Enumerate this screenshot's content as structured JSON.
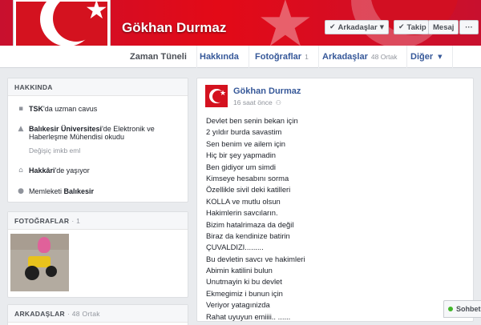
{
  "profile": {
    "name": "Gökhan Durmaz",
    "buttons": {
      "friends": "Arkadaşlar",
      "follow": "Takip",
      "message": "Mesaj",
      "more": "···"
    }
  },
  "nav": {
    "tabs": [
      {
        "label": "Zaman Tüneli",
        "count": ""
      },
      {
        "label": "Hakkında",
        "count": ""
      },
      {
        "label": "Fotoğraflar",
        "count": "1"
      },
      {
        "label": "Arkadaşlar",
        "count": "48 Ortak"
      },
      {
        "label": "Diğer",
        "count": ""
      }
    ]
  },
  "about": {
    "header": "HAKKINDA",
    "work": {
      "link": "TSK",
      "rest": "'da uzman cavus"
    },
    "education": {
      "link": "Balıkesir Üniversitesi",
      "rest": "'de Elektronik ve",
      "line2": "Haberleşme Mühendisi okudu",
      "sub": "Değişiç imkb eml"
    },
    "lives": {
      "link": "Hakkâri",
      "rest": "'de yaşıyor"
    },
    "from": {
      "prefix": "Memleketi ",
      "link": "Balıkesir"
    }
  },
  "photos": {
    "header": "FOTOĞRAFLAR",
    "count": "· 1"
  },
  "friends": {
    "header": "ARKADAŞLAR",
    "count": "· 48 Ortak"
  },
  "post": {
    "author": "Gökhan Durmaz",
    "time": "16 saat önce",
    "lines": [
      "Devlet ben senin bekan için",
      "2 yıldır burda savastim",
      "Sen benim ve ailem için",
      "Hiç bir şey yapmadin",
      "Ben gidiyor um simdi",
      "Kimseye hesabını sorma",
      "Özellikle sivil deki katilleri",
      "KOLLA ve mutlu olsun",
      "Hakimlerin savcıların.",
      "Bizim hatalrimaza da değil",
      "Biraz da kendinize batirin",
      "ÇUVALDIZI.........",
      "Bu devletin savcı ve hakimleri",
      "Abimin katilini bulun",
      "Unutmayin ki bu devlet",
      "Ekmegimiz i bunun için",
      "Veriyor yatagınizda",
      "Rahat uyuyun emiiii.. ......"
    ]
  },
  "chat": {
    "label": "Sohbet"
  }
}
